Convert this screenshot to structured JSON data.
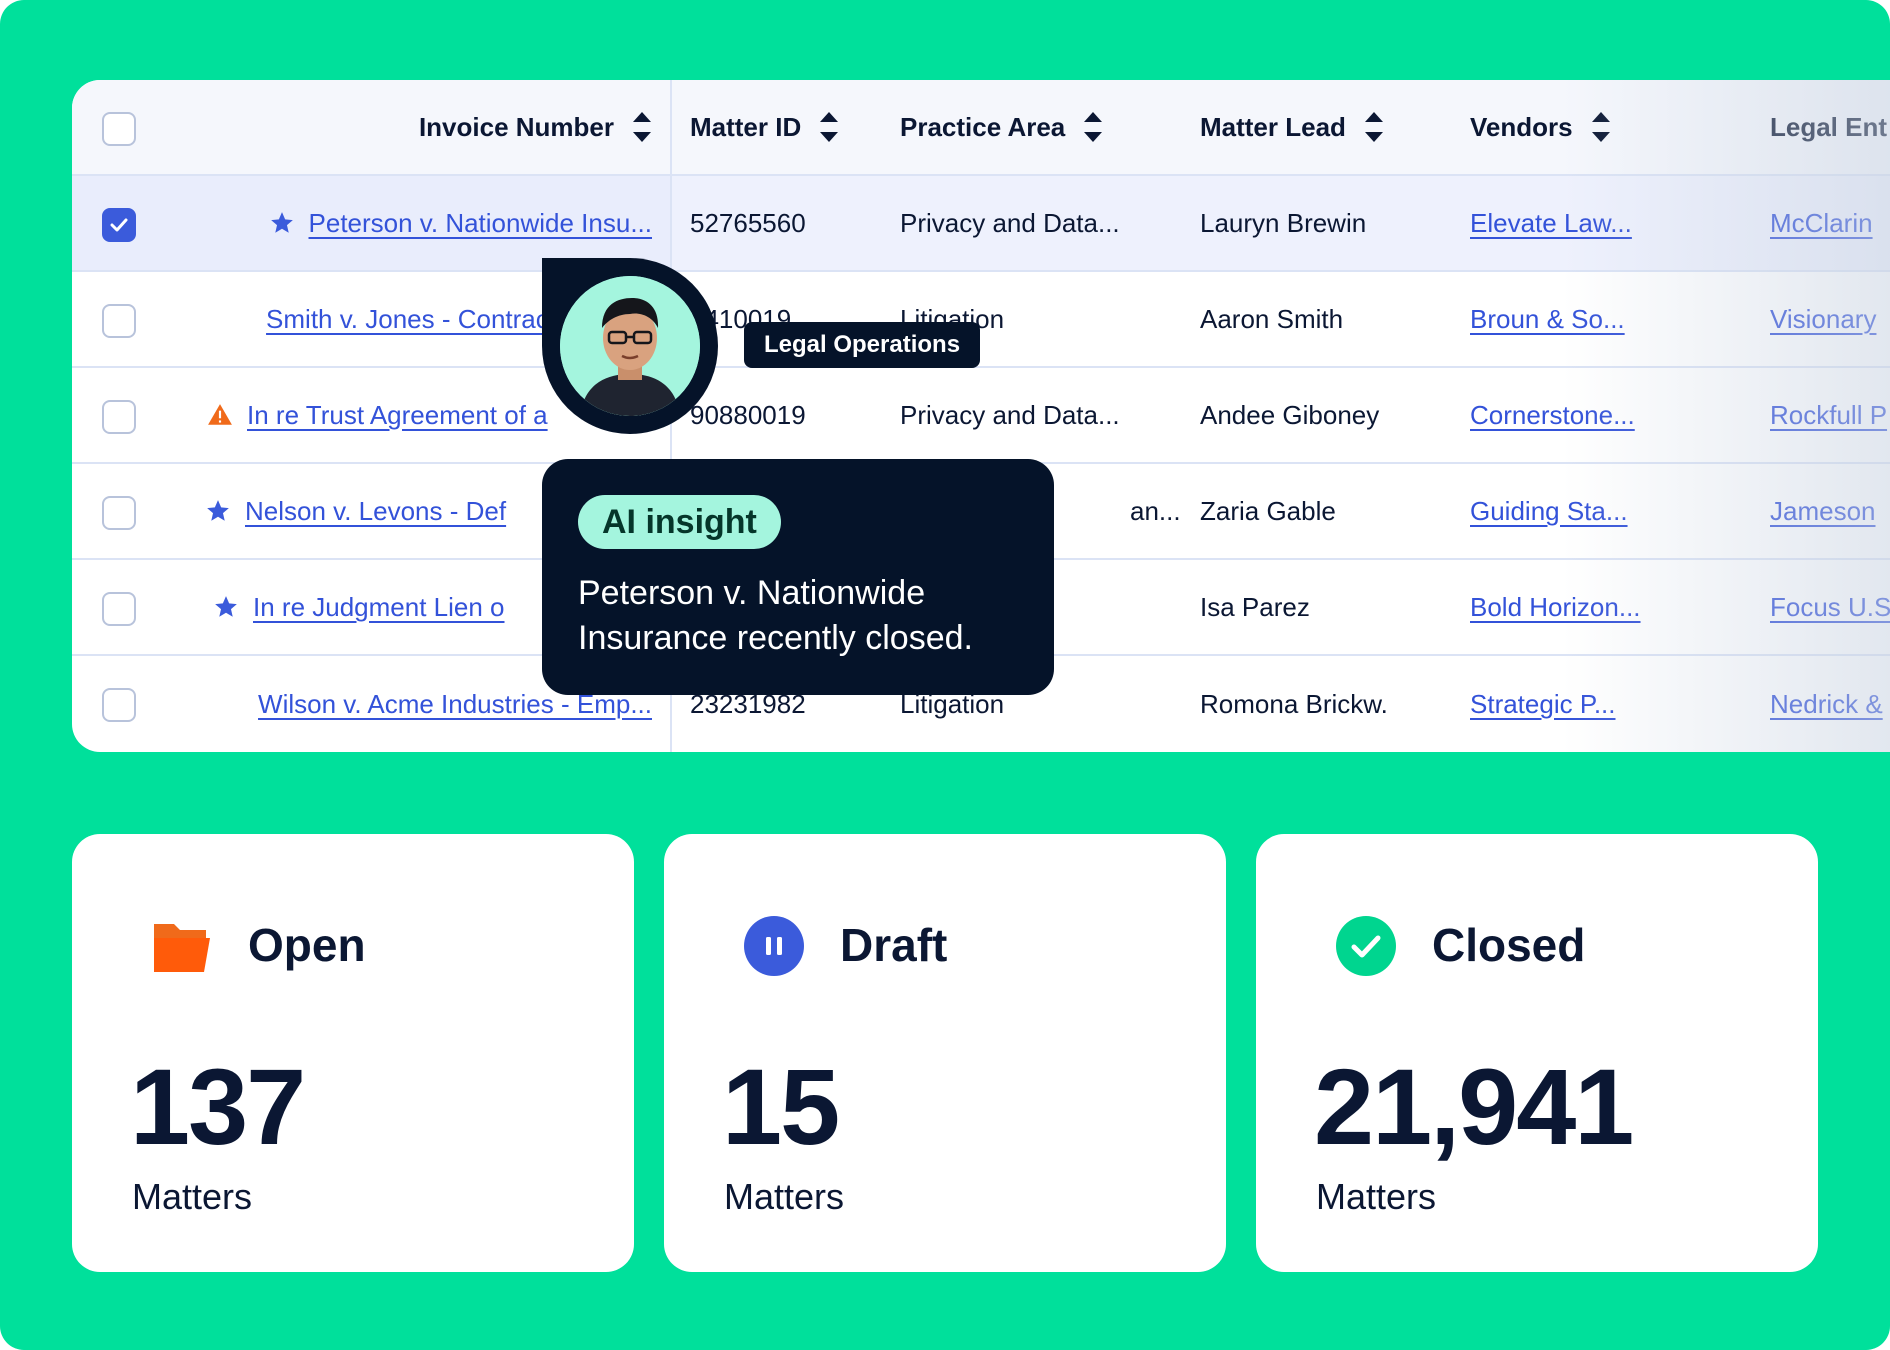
{
  "colors": {
    "background": "#00E09B",
    "link": "#3352d9",
    "dark": "#051329",
    "accent_blue": "#3b5bdb",
    "warning": "#f06a1a",
    "insight_badge": "#a4f5de"
  },
  "table": {
    "columns": [
      {
        "label": "Invoice Number",
        "icon": "sort-icon"
      },
      {
        "label": "Matter ID",
        "icon": "sort-icon"
      },
      {
        "label": "Practice Area",
        "icon": "sort-icon"
      },
      {
        "label": "Matter Lead",
        "icon": "sort-icon"
      },
      {
        "label": "Vendors",
        "icon": "sort-icon"
      },
      {
        "label": "Legal Ent"
      }
    ],
    "rows": [
      {
        "selected": true,
        "lead_icon": "star-icon",
        "invoice": "Peterson v. Nationwide Insu...",
        "matter_id": "52765560",
        "practice_area": "Privacy and Data...",
        "matter_lead": "Lauryn Brewin",
        "vendor": "Elevate Law...",
        "entity": "McClarin"
      },
      {
        "selected": false,
        "lead_icon": "",
        "invoice": "Smith v. Jones - Contract",
        "matter_id": "4410019",
        "practice_area": "Litigation",
        "matter_lead": "Aaron Smith",
        "vendor": "Broun & So...",
        "entity": "Visionary"
      },
      {
        "selected": false,
        "lead_icon": "warning-icon",
        "invoice": "In re Trust Agreement of a",
        "matter_id": "90880019",
        "practice_area": "Privacy and Data...",
        "matter_lead": "Andee Giboney",
        "vendor": "Cornerstone...",
        "entity": "Rockfull P"
      },
      {
        "selected": false,
        "lead_icon": "star-icon",
        "invoice": "Nelson v. Levons - Def",
        "matter_id": "",
        "practice_area": "an...",
        "matter_lead": "Zaria Gable",
        "vendor": "Guiding Sta...",
        "entity": "Jameson"
      },
      {
        "selected": false,
        "lead_icon": "star-icon",
        "invoice": "In re Judgment Lien o",
        "matter_id": "",
        "practice_area": "",
        "matter_lead": "Isa Parez",
        "vendor": "Bold Horizon...",
        "entity": "Focus U.S"
      },
      {
        "selected": false,
        "lead_icon": "",
        "invoice": "Wilson v. Acme Industries - Emp...",
        "matter_id": "23231982",
        "practice_area": "Litigation",
        "matter_lead": "Romona Brickw.",
        "vendor": "Strategic P...",
        "entity": "Nedrick &"
      }
    ]
  },
  "profile": {
    "role": "Legal Operations"
  },
  "insight": {
    "badge": "AI insight",
    "text": "Peterson v. Nationwide Insurance recently closed."
  },
  "stats": [
    {
      "title": "Open",
      "icon": "folder-icon",
      "value": "137",
      "unit": "Matters"
    },
    {
      "title": "Draft",
      "icon": "pause-icon",
      "value": "15",
      "unit": "Matters"
    },
    {
      "title": "Closed",
      "icon": "check-circle-icon",
      "value": "21,941",
      "unit": "Matters"
    }
  ]
}
